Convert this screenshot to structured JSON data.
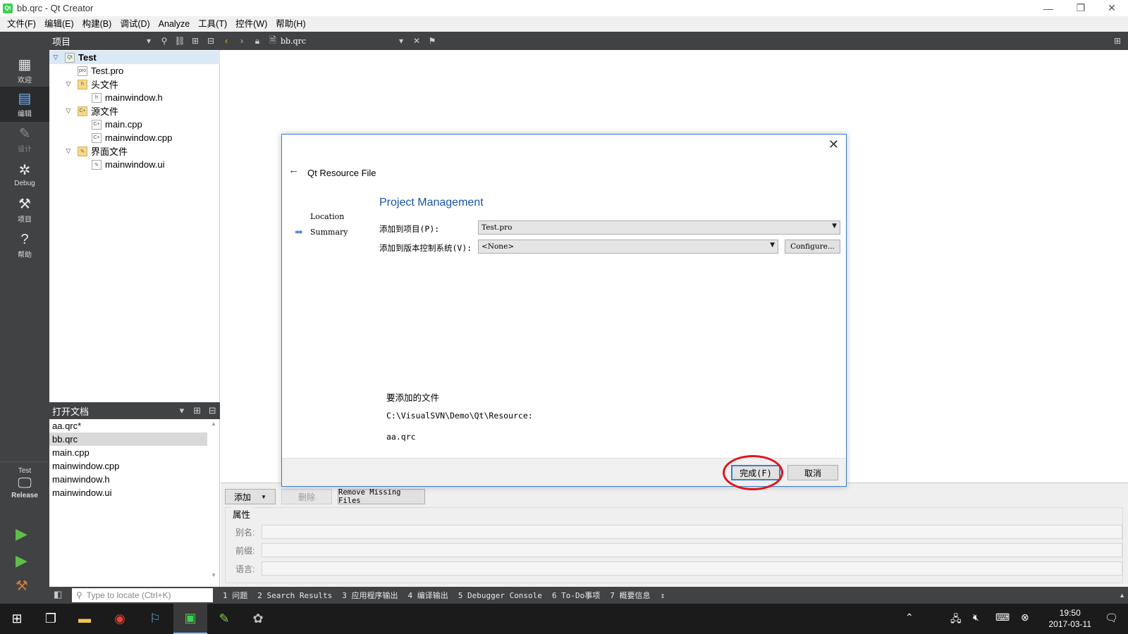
{
  "window": {
    "title": "bb.qrc - Qt Creator",
    "app_icon_label": "Qt",
    "controls": {
      "minimize": "—",
      "restore": "❐",
      "close": "✕"
    }
  },
  "menu": [
    "文件(F)",
    "编辑(E)",
    "构建(B)",
    "调试(D)",
    "Analyze",
    "工具(T)",
    "控件(W)",
    "帮助(H)"
  ],
  "modes": [
    {
      "label": "欢迎",
      "icon": "grid-icon"
    },
    {
      "label": "编辑",
      "icon": "edit-document-icon"
    },
    {
      "label": "设计",
      "icon": "pencil-icon"
    },
    {
      "label": "Debug",
      "icon": "bug-icon"
    },
    {
      "label": "项目",
      "icon": "wrench-icon"
    },
    {
      "label": "帮助",
      "icon": "help-icon"
    }
  ],
  "kit": {
    "project": "Test",
    "config": "Release"
  },
  "toolbar": {
    "panel_title": "项目",
    "current_file": "bb.qrc"
  },
  "tree": [
    {
      "label": "Test",
      "level": 0,
      "expanded": true,
      "kind": "project",
      "selected": true
    },
    {
      "label": "Test.pro",
      "level": 1,
      "kind": "pro"
    },
    {
      "label": "头文件",
      "level": 1,
      "expanded": true,
      "kind": "folder"
    },
    {
      "label": "mainwindow.h",
      "level": 2,
      "kind": "h"
    },
    {
      "label": "源文件",
      "level": 1,
      "expanded": true,
      "kind": "folder"
    },
    {
      "label": "main.cpp",
      "level": 2,
      "kind": "cpp"
    },
    {
      "label": "mainwindow.cpp",
      "level": 2,
      "kind": "cpp"
    },
    {
      "label": "界面文件",
      "level": 1,
      "expanded": true,
      "kind": "folder"
    },
    {
      "label": "mainwindow.ui",
      "level": 2,
      "kind": "ui"
    }
  ],
  "open_docs": {
    "title": "打开文档",
    "items": [
      "aa.qrc*",
      "bb.qrc",
      "main.cpp",
      "mainwindow.cpp",
      "mainwindow.h",
      "mainwindow.ui"
    ],
    "selected_index": 1
  },
  "resource_editor": {
    "add_label": "添加",
    "remove_label": "删除",
    "remove_missing_label": "Remove Missing Files",
    "properties_title": "属性",
    "alias_label": "别名:",
    "prefix_label": "前缀:",
    "language_label": "语言:"
  },
  "output": {
    "locator_placeholder": "Type to locate (Ctrl+K)",
    "tabs": [
      "1 问题",
      "2 Search Results",
      "3 应用程序输出",
      "4 编译输出",
      "5 Debugger Console",
      "6 To-Do事项",
      "7 概要信息"
    ]
  },
  "dialog": {
    "wizard_title": "Qt Resource File",
    "steps": [
      "Location",
      "Summary"
    ],
    "current_step": 1,
    "page_title": "Project Management",
    "add_to_project_label": "添加到项目(P):",
    "add_to_project_value": "Test.pro",
    "vcs_label": "添加到版本控制系统(V):",
    "vcs_value": "<None>",
    "configure_label": "Configure...",
    "files_label": "要添加的文件",
    "path": "C:\\VisualSVN\\Demo\\Qt\\Resource:",
    "file": "aa.qrc",
    "finish_label": "完成(F)",
    "cancel_label": "取消"
  },
  "taskbar": {
    "time": "19:50",
    "date": "2017-03-11"
  },
  "colors": {
    "accent": "#3c7fc8",
    "sidebar": "#404244",
    "highlight": "#e0151a"
  }
}
